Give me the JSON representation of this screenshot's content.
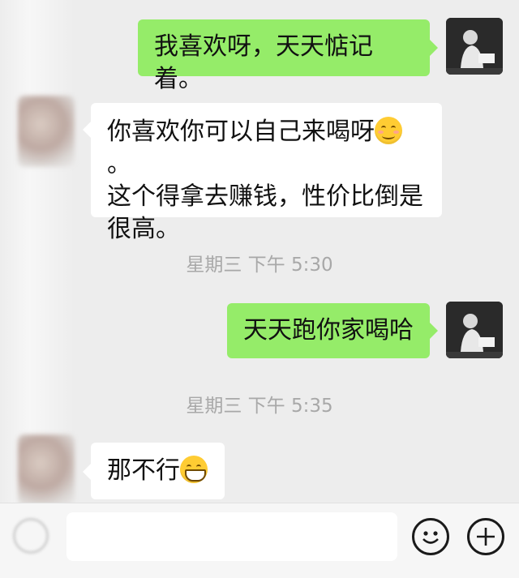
{
  "messages": [
    {
      "side": "self",
      "text": "我喜欢呀，天天惦记着。"
    },
    {
      "side": "other",
      "text_a": "你喜欢你可以自己来喝呀",
      "text_b": "。",
      "text_c": "这个得拿去赚钱，性价比倒是",
      "text_d": "很高。",
      "emoji": "smiling-face-icon"
    },
    {
      "type": "timestamp",
      "text": "星期三 下午 5:30"
    },
    {
      "side": "self",
      "text": "天天跑你家喝哈"
    },
    {
      "type": "timestamp",
      "text": "星期三 下午 5:35"
    },
    {
      "side": "other",
      "text": "那不行",
      "emoji": "grinning-face-icon"
    }
  ],
  "input_bar": {
    "placeholder": "",
    "icons": [
      "voice-icon",
      "emoji-icon",
      "plus-icon"
    ]
  },
  "colors": {
    "self_bubble": "#95ec69",
    "other_bubble": "#ffffff",
    "background": "#ededed"
  }
}
